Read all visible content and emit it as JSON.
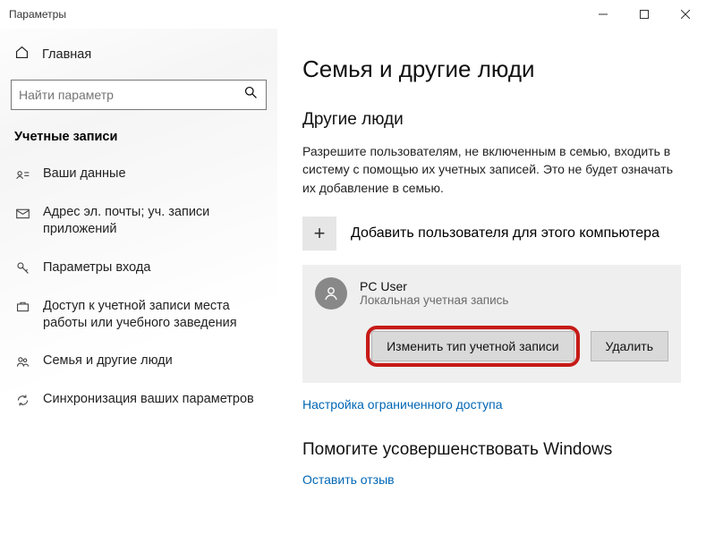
{
  "titlebar": {
    "title": "Параметры"
  },
  "sidebar": {
    "home_label": "Главная",
    "search_placeholder": "Найти параметр",
    "category_label": "Учетные записи",
    "items": [
      {
        "label": "Ваши данные"
      },
      {
        "label": "Адрес эл. почты; уч. записи приложений"
      },
      {
        "label": "Параметры входа"
      },
      {
        "label": "Доступ к учетной записи места работы или учебного заведения"
      },
      {
        "label": "Семья и другие люди"
      },
      {
        "label": "Синхронизация ваших параметров"
      }
    ]
  },
  "main": {
    "page_title": "Семья и другие люди",
    "section_other_title": "Другие люди",
    "section_other_desc": "Разрешите пользователям, не включенным в семью, входить в систему с помощью их учетных записей. Это не будет означать их добавление в семью.",
    "add_user_label": "Добавить пользователя для этого компьютера",
    "user": {
      "name": "PC User",
      "type": "Локальная учетная запись"
    },
    "change_type_label": "Изменить тип учетной записи",
    "delete_label": "Удалить",
    "restricted_link": "Настройка ограниченного доступа",
    "help_title": "Помогите усовершенствовать Windows",
    "feedback_link": "Оставить отзыв"
  }
}
